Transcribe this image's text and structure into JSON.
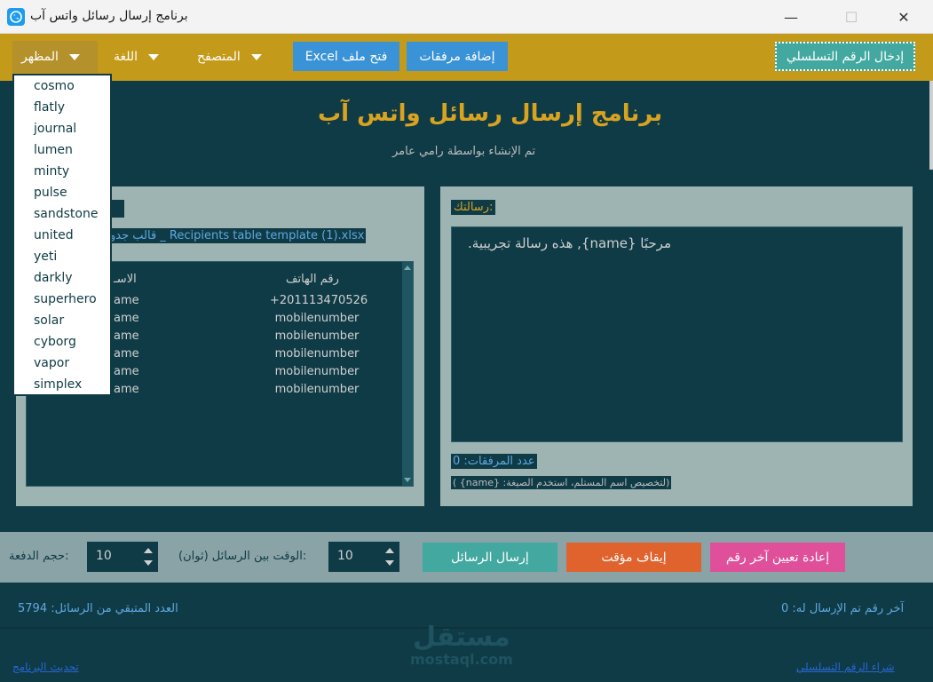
{
  "window": {
    "title": "برنامج إرسال رسائل واتس آب",
    "min_glyph": "—",
    "max_glyph": "☐",
    "close_glyph": "✕"
  },
  "menubar": {
    "appearance": "المظهر",
    "language": "اللغة",
    "browser": "المتصفح",
    "open_excel": "Excel فتح ملف",
    "add_attachments": "إضافة مرفقات",
    "enter_serial": "إدخال الرقم التسلسلي"
  },
  "theme_dropdown": {
    "options": [
      "cosmo",
      "flatly",
      "journal",
      "lumen",
      "minty",
      "pulse",
      "sandstone",
      "united",
      "yeti",
      "darkly",
      "superhero",
      "solar",
      "cyborg",
      "vapor",
      "simplex"
    ]
  },
  "header": {
    "title": "برنامج إرسال رسائل واتس آب",
    "subtitle": "تم الإنشاء بواسطة رامي عامر"
  },
  "recipients": {
    "file_name": "قالب جدو _ Recipients table template (1).xlsx",
    "col_name": "الاسـ",
    "col_phone": "رقم الهاتف",
    "rows": [
      {
        "name": "ame",
        "phone": "+201113470526"
      },
      {
        "name": "ame",
        "phone": "mobilenumber"
      },
      {
        "name": "ame",
        "phone": "mobilenumber"
      },
      {
        "name": "ame",
        "phone": "mobilenumber"
      },
      {
        "name": "ame",
        "phone": "mobilenumber"
      },
      {
        "name": "ame",
        "phone": "mobilenumber"
      }
    ]
  },
  "message": {
    "label": "رسالتك:",
    "text": ".هذه رسالة تجريبية ,{name} مرحبًا",
    "attachments_count": "عدد المرفقات: 0",
    "hint": "( {name} :لتخصيص اسم المستلم، استخدم الصيغة)"
  },
  "controls": {
    "batch_label": "حجم الدفعة:",
    "batch_value": "10",
    "interval_label": "الوقت بين الرسائل (ثوان):",
    "interval_value": "10",
    "send": "إرسال الرسائل",
    "pause": "إيقاف مؤقت",
    "reset": "إعادة تعيين آخر رقم"
  },
  "footer": {
    "remaining": "العدد المتبقي من الرسائل: 5794",
    "last_sent": "آخر رقم تم الإرسال له: 0",
    "update_link": "تحديث البرنامج",
    "buy_serial_link": "شراء الرقم التسلسلي",
    "watermark_ar": "مستقل",
    "watermark_en": "mostaql.com"
  },
  "colors": {
    "menubar": "#c49a1a",
    "background": "#0f3b46",
    "accent_gold": "#d9a320",
    "send": "#42a8a0",
    "pause": "#e0632e",
    "reset": "#e0509a",
    "primary": "#3a93d6"
  }
}
